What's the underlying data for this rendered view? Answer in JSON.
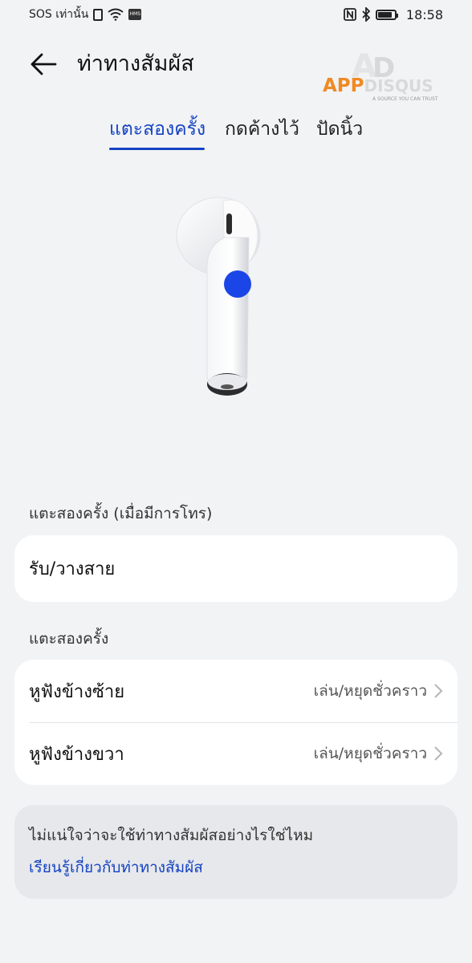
{
  "status_bar": {
    "carrier": "SOS เท่านั้น",
    "hms_badge": "HMS",
    "time": "18:58",
    "battery_level": 0.85
  },
  "header": {
    "title": "ท่าทางสัมผัส",
    "logo": {
      "app": "APP",
      "disqus": "DISQUS",
      "tagline": "A SOURCE YOU CAN TRUST"
    }
  },
  "tabs": [
    {
      "label": "แตะสองครั้ง",
      "active": true
    },
    {
      "label": "กดค้างไว้",
      "active": false
    },
    {
      "label": "ปัดนิ้ว",
      "active": false
    }
  ],
  "sections": {
    "calls_label": "แตะสองครั้ง (เมื่อมีการโทร)",
    "calls_option": "รับ/วางสาย",
    "double_tap_label": "แตะสองครั้ง",
    "left_ear": {
      "title": "หูฟังข้างซ้าย",
      "value": "เล่น/หยุดชั่วคราว"
    },
    "right_ear": {
      "title": "หูฟังข้างขวา",
      "value": "เล่น/หยุดชั่วคราว"
    }
  },
  "help": {
    "text": "ไม่แน่ใจว่าจะใช้ท่าทางสัมผัสอย่างไรใช่ไหม",
    "link": "เรียนรู้เกี่ยวกับท่าทางสัมผัส"
  },
  "colors": {
    "accent": "#1442c2",
    "tap_indicator": "#1a46e8",
    "background": "#f1f3f5"
  }
}
